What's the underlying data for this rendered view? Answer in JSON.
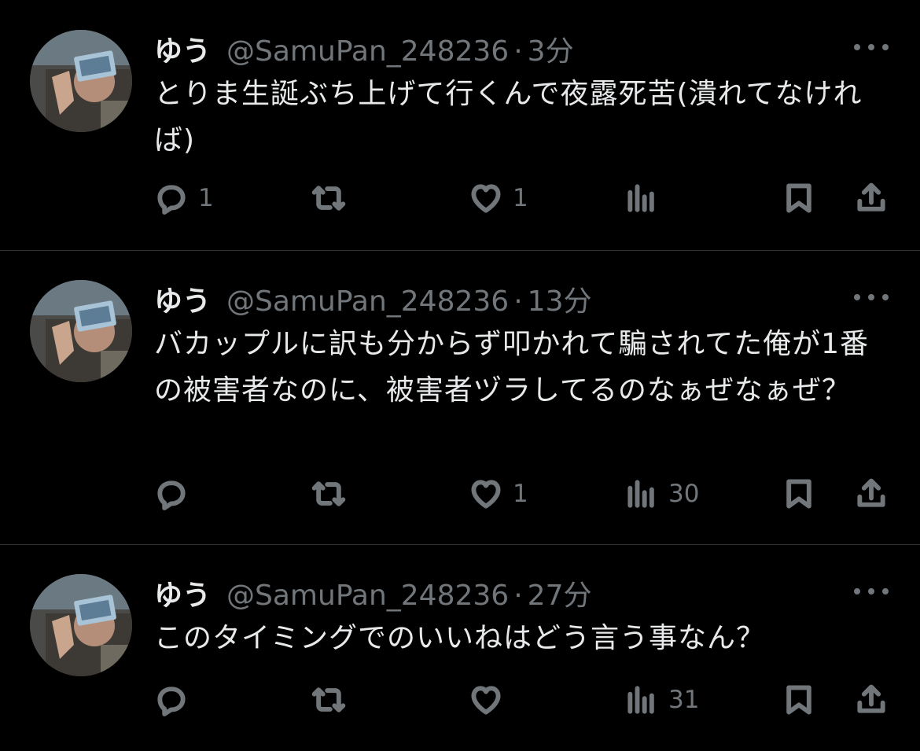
{
  "colors": {
    "background": "#000000",
    "text": "#e7e9ea",
    "muted": "#71767b",
    "divider": "#2f3336"
  },
  "tweets": [
    {
      "name": "ゆう",
      "handle": "@SamuPan_248236",
      "separator": "·",
      "time": "3分",
      "text": "とりま生誕ぶち上げて行くんで夜露死苦(潰れてなければ)",
      "replies": "1",
      "retweets": "",
      "likes": "1",
      "views": ""
    },
    {
      "name": "ゆう",
      "handle": "@SamuPan_248236",
      "separator": "·",
      "time": "13分",
      "text": "バカップルに訳も分からず叩かれて騙されてた俺が1番の被害者なのに、被害者ヅラしてるのなぁぜなぁぜ？",
      "replies": "",
      "retweets": "",
      "likes": "1",
      "views": "30"
    },
    {
      "name": "ゆう",
      "handle": "@SamuPan_248236",
      "separator": "·",
      "time": "27分",
      "text": "このタイミングでのいいねはどう言う事なん？",
      "replies": "",
      "retweets": "",
      "likes": "",
      "views": "31"
    }
  ],
  "icons": {
    "reply": "reply-icon",
    "retweet": "retweet-icon",
    "like": "heart-icon",
    "views": "views-icon",
    "bookmark": "bookmark-icon",
    "share": "share-icon",
    "more": "more-icon"
  }
}
